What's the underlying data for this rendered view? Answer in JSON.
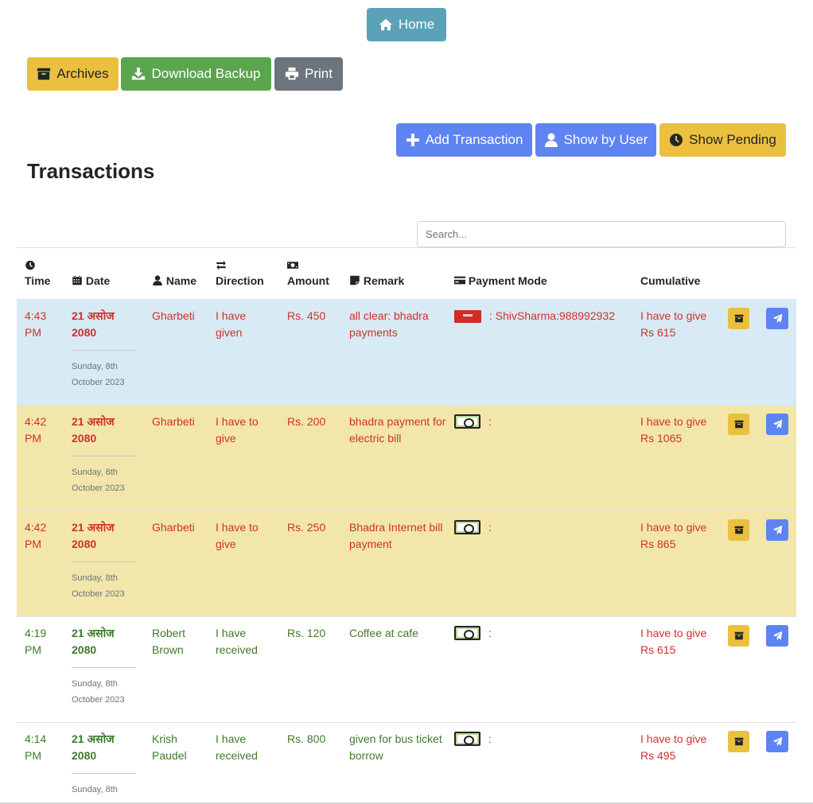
{
  "toolbar": {
    "home_label": "Home",
    "archives_label": "Archives",
    "backup_label": "Download Backup",
    "print_label": "Print",
    "add_label": "Add Transaction",
    "user_label": "Show by User",
    "pending_label": "Show Pending"
  },
  "page_title": "Transactions",
  "search": {
    "placeholder": "Search..."
  },
  "table": {
    "headers": {
      "time": "Time",
      "date": "Date",
      "name": "Name",
      "direction": "Direction",
      "amount": "Amount",
      "remark": "Remark",
      "payment_mode": "Payment Mode",
      "cumulative": "Cumulative"
    },
    "rows": [
      {
        "time": "4:43 PM",
        "date": "21 असोज 2080",
        "date_sub": "Sunday, 8th October 2023",
        "name": "Gharbeti",
        "direction": "I have given",
        "amount": "Rs. 450",
        "remark": "all clear: bhadra payments",
        "payment_type": "card",
        "payment_detail": ": ShivSharma:988992932",
        "cumulative": "I have to give Rs 615"
      },
      {
        "time": "4:42 PM",
        "date": "21 असोज 2080",
        "date_sub": "Sunday, 8th October 2023",
        "name": "Gharbeti",
        "direction": "I have to give",
        "amount": "Rs. 200",
        "remark": "bhadra payment for electric bill",
        "payment_type": "cash",
        "payment_detail": ":",
        "cumulative": "I have to give Rs 1065"
      },
      {
        "time": "4:42 PM",
        "date": "21 असोज 2080",
        "date_sub": "Sunday, 8th October 2023",
        "name": "Gharbeti",
        "direction": "I have to give",
        "amount": "Rs. 250",
        "remark": "Bhadra Internet bill payment",
        "payment_type": "cash",
        "payment_detail": ":",
        "cumulative": "I have to give Rs 865"
      },
      {
        "time": "4:19 PM",
        "date": "21 असोज 2080",
        "date_sub": "Sunday, 8th October 2023",
        "name": "Robert Brown",
        "direction": "I have received",
        "amount": "Rs. 120",
        "remark": "Coffee at cafe",
        "payment_type": "cash",
        "payment_detail": ":",
        "cumulative": "I have to give Rs 615"
      },
      {
        "time": "4:14 PM",
        "date": "21 असोज 2080",
        "date_sub": "Sunday, 8th",
        "name": "Krish Paudel",
        "direction": "I have received",
        "amount": "Rs. 800",
        "remark": "given for bus ticket borrow",
        "payment_type": "cash",
        "payment_detail": ":",
        "cumulative": "I have to give Rs 495"
      }
    ]
  },
  "colors": {
    "info_row": "#d8eaf3",
    "warning_row": "#f2e6aa",
    "primary": "#5e83f2",
    "warning": "#ebc03f",
    "success": "#5ba54f",
    "secondary": "#6c757d",
    "home": "#5ba2b8",
    "red_text": "#d0312d",
    "green_text": "#3f7a2c"
  }
}
